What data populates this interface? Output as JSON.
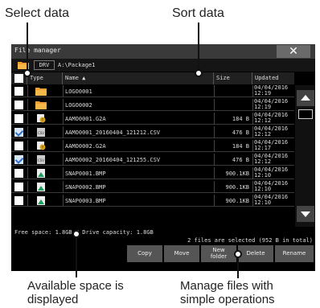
{
  "callouts": {
    "select_data": "Select data",
    "sort_data": "Sort data",
    "available_space_line1": "Available space is",
    "available_space_line2": "displayed",
    "manage_line1": "Manage files with",
    "manage_line2": "simple operations"
  },
  "window": {
    "title": "File manager",
    "close_label": "✕",
    "drive_label": "DRV",
    "path": "A:\\Package1"
  },
  "columns": {
    "type": "Type",
    "name": "Name ▲",
    "size": "Size",
    "updated": "Updated"
  },
  "files": [
    {
      "name": "LOGO0001",
      "icon": "folder-icon",
      "size": "",
      "date": "04/04/2016",
      "time": "12:19",
      "checked": false
    },
    {
      "name": "LOGO0002",
      "icon": "folder-icon",
      "size": "",
      "date": "04/04/2016",
      "time": "12:19",
      "checked": false
    },
    {
      "name": "AAMO0001.G2A",
      "icon": "alarm-file-icon",
      "size": "184 B",
      "date": "04/04/2016",
      "time": "12:12",
      "checked": false
    },
    {
      "name": "AAMO0001_20160404_121212.CSV",
      "icon": "csv-file-icon",
      "size": "476 B",
      "date": "04/04/2016",
      "time": "12:12",
      "checked": true
    },
    {
      "name": "AAMO0002.G2A",
      "icon": "alarm-file-icon",
      "size": "184 B",
      "date": "04/04/2016",
      "time": "12:17",
      "checked": false
    },
    {
      "name": "AAMO0002_20160404_121255.CSV",
      "icon": "csv-file-icon",
      "size": "476 B",
      "date": "04/04/2016",
      "time": "12:12",
      "checked": true
    },
    {
      "name": "SNAP0001.BMP",
      "icon": "image-file-icon",
      "size": "900.1KB",
      "date": "04/04/2016",
      "time": "12:10",
      "checked": false
    },
    {
      "name": "SNAP0002.BMP",
      "icon": "image-file-icon",
      "size": "900.1KB",
      "date": "04/04/2016",
      "time": "12:10",
      "checked": false
    },
    {
      "name": "SNAP0003.BMP",
      "icon": "image-file-icon",
      "size": "900.1KB",
      "date": "04/04/2016",
      "time": "12:10",
      "checked": false
    }
  ],
  "status": {
    "space": "Free space:  1.8GB / Drive capacity:  1.8GB",
    "selection": "2 files are selected (952 B in total)"
  },
  "buttons": {
    "copy": "Copy",
    "move": "Move",
    "new_folder_line1": "New",
    "new_folder_line2": "folder",
    "delete": "Delete",
    "rename": "Rename"
  },
  "colors": {
    "folder": "#f0a030",
    "csv": "#cccccc",
    "image": "#1e9e5a",
    "alarm": "#d9a21f"
  }
}
